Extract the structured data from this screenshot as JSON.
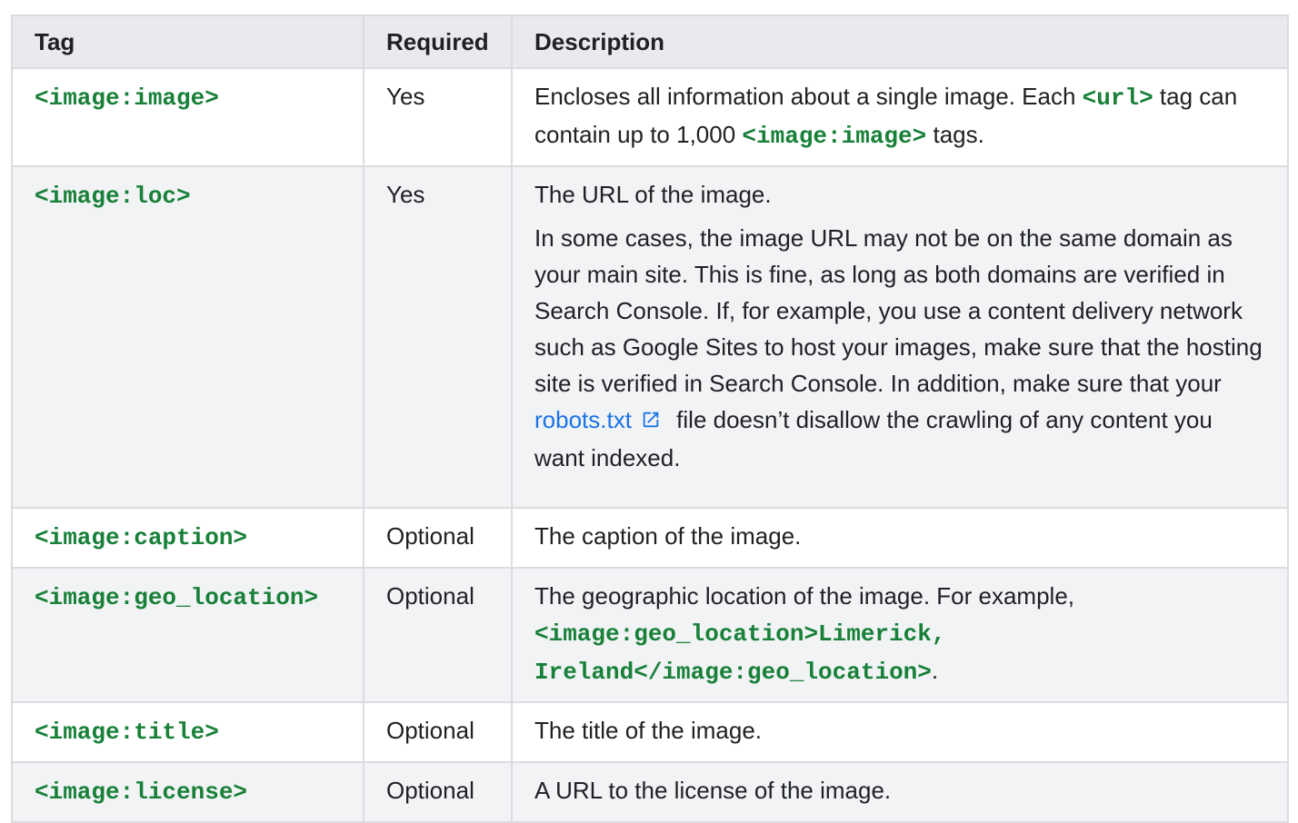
{
  "headers": {
    "tag": "Tag",
    "required": "Required",
    "description": "Description"
  },
  "rows": [
    {
      "tag": "<image:image>",
      "required": "Yes",
      "desc": {
        "t1": "Encloses all information about a single image. Each ",
        "c1": "<url>",
        "t2": " tag can contain up to 1,000 ",
        "c2": "<image:image>",
        "t3": " tags."
      }
    },
    {
      "tag": "<image:loc>",
      "required": "Yes",
      "desc": {
        "p1": "The URL of the image.",
        "p2a": "In some cases, the image URL may not be on the same domain as your main site. This is fine, as long as both domains are verified in Search Console. If, for example, you use a content delivery network such as Google Sites to host your images, make sure that the hosting site is verified in Search Console. In addition, make sure that your ",
        "link": "robots.txt",
        "p2b": " file doesn’t disallow the crawling of any content you want indexed."
      }
    },
    {
      "tag": "<image:caption>",
      "required": "Optional",
      "desc": {
        "text": "The caption of the image."
      }
    },
    {
      "tag": "<image:geo_location>",
      "required": "Optional",
      "desc": {
        "t1": "The geographic location of the image. For example, ",
        "c1": "<image:geo_location>Limerick, Ireland</image:geo_location>",
        "t2": "."
      }
    },
    {
      "tag": "<image:title>",
      "required": "Optional",
      "desc": {
        "text": "The title of the image."
      }
    },
    {
      "tag": "<image:license>",
      "required": "Optional",
      "desc": {
        "text": "A URL to the license of the image."
      }
    }
  ],
  "colors": {
    "code": "#188038",
    "link": "#1a73e8",
    "header_bg": "#e8eaed",
    "shaded_row_bg": "#f1f3f4",
    "border": "#dadce0"
  },
  "icons": {
    "external_link": "external-link-icon"
  }
}
